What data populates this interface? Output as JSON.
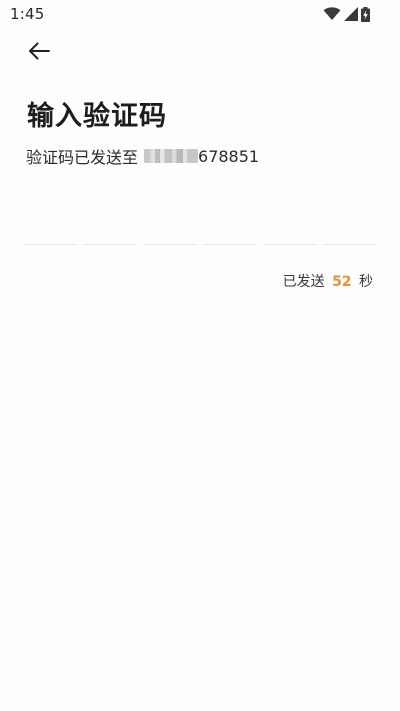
{
  "status_bar": {
    "time": "1:45",
    "icons": [
      "wifi-icon",
      "cellular-signal-icon",
      "battery-charging-icon"
    ]
  },
  "header": {
    "back_icon": "arrow-left-icon"
  },
  "main": {
    "title": "输入验证码",
    "sent_to_label": "验证码已发送至",
    "phone_visible_suffix": "678851",
    "code_length": 6,
    "countdown_prefix": "已发送",
    "countdown_seconds": "52",
    "countdown_suffix": "秒"
  },
  "colors": {
    "accent": "#e8903a",
    "text_primary": "#1d1d1d",
    "divider": "#e4e4e4",
    "background": "#fdfdfd"
  }
}
